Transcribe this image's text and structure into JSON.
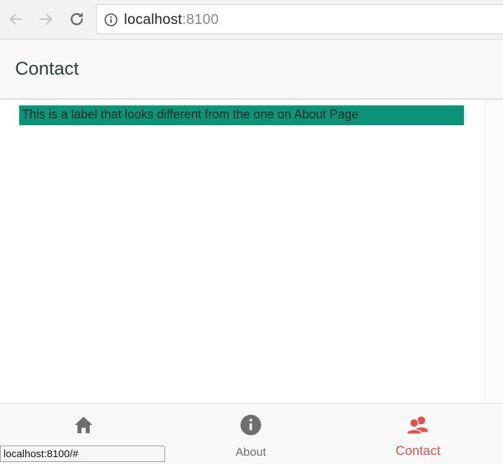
{
  "browser": {
    "url_host": "localhost",
    "url_port": ":8100",
    "status_url": "localhost:8100/#"
  },
  "header": {
    "title": "Contact"
  },
  "content": {
    "label_text": "This is a label that looks different from the one on About Page",
    "label_background": "#0d9478"
  },
  "tabs": [
    {
      "label": "",
      "icon": "home-icon",
      "selected": false
    },
    {
      "label": "About",
      "icon": "info-icon",
      "selected": false
    },
    {
      "label": "Contact",
      "icon": "contacts-icon",
      "selected": true
    }
  ],
  "colors": {
    "accent": "#e0524f",
    "tab_inactive": "#6e6e6e"
  }
}
